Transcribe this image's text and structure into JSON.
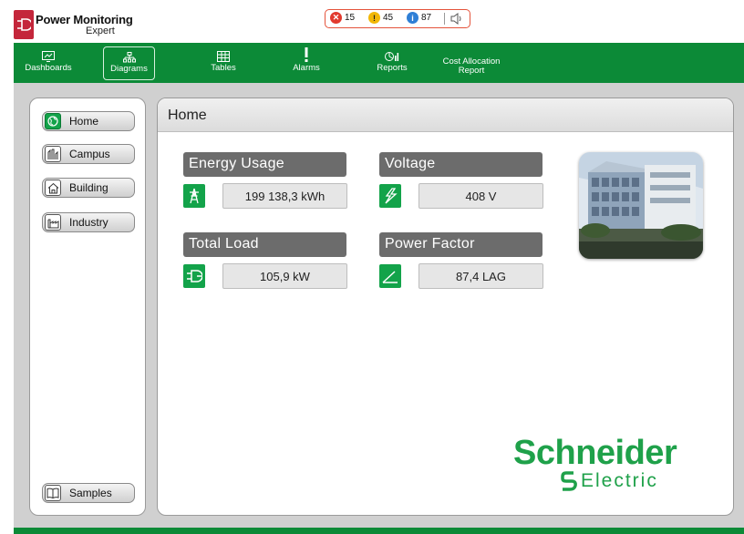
{
  "app": {
    "title": "Power Monitoring",
    "subtitle": "Expert"
  },
  "alarms": {
    "critical": "15",
    "warning": "45",
    "info": "87"
  },
  "nav": {
    "dashboards": "Dashboards",
    "diagrams": "Diagrams",
    "tables": "Tables",
    "alarms": "Alarms",
    "reports": "Reports",
    "cost_allocation_line1": "Cost Allocation",
    "cost_allocation_line2": "Report"
  },
  "sidebar": {
    "home": "Home",
    "campus": "Campus",
    "building": "Building",
    "industry": "Industry",
    "samples": "Samples"
  },
  "main": {
    "title": "Home",
    "energy_label": "Energy Usage",
    "energy_value": "199 138,3  kWh",
    "voltage_label": "Voltage",
    "voltage_value": "408  V",
    "load_label": "Total Load",
    "load_value": "105,9  kW",
    "pf_label": "Power Factor",
    "pf_value": "87,4  LAG"
  },
  "brand": {
    "top": "Schneider",
    "bottom": "Electric"
  },
  "colors": {
    "green": "#0c8a37",
    "accent_green": "#13a34a",
    "brand_green": "#1fa14a",
    "logo_red": "#c4263b",
    "alarm_border": "#e4533b"
  }
}
